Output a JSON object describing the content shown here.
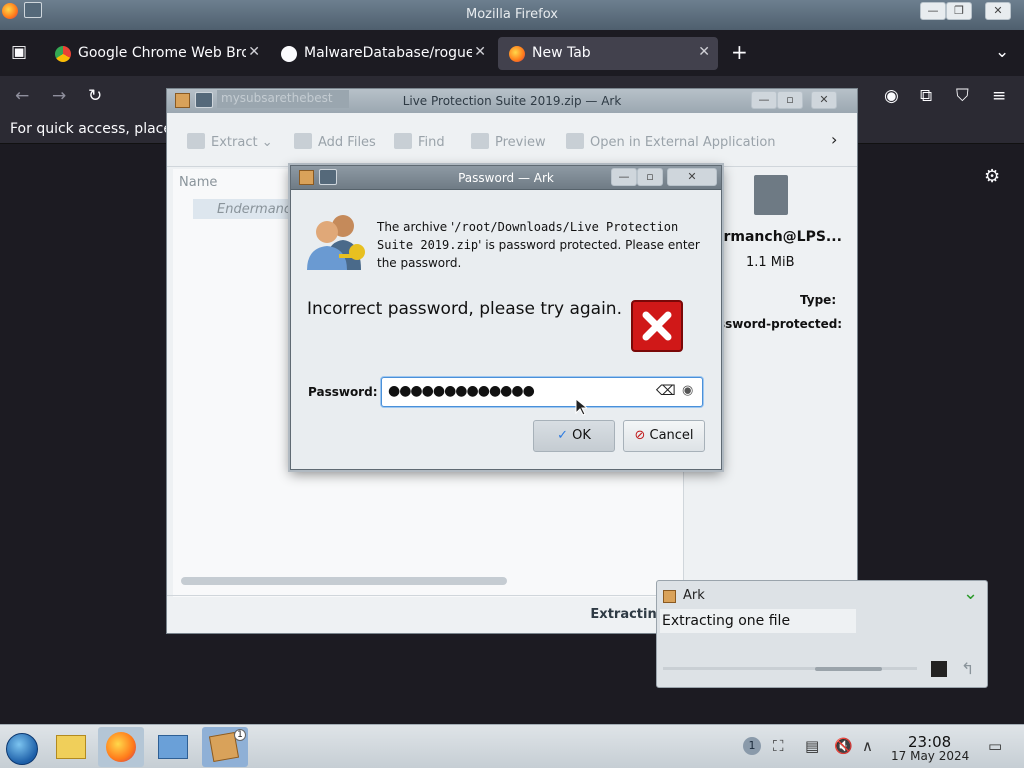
{
  "firefox": {
    "window_title": "Mozilla Firefox",
    "tabs": [
      {
        "label": "Google Chrome Web Bro",
        "active": false
      },
      {
        "label": "MalwareDatabase/rogue",
        "active": false
      },
      {
        "label": "New Tab",
        "active": true
      }
    ],
    "bookmarks_hint": "For quick access, place y"
  },
  "ark": {
    "window_title": "Live Protection Suite 2019.zip — Ark",
    "titlebar_overlay": "mysubsarethebest",
    "toolbar": {
      "extract": "Extract",
      "add_files": "Add Files",
      "find": "Find",
      "preview": "Preview",
      "open_external": "Open in External Application"
    },
    "list": {
      "column_name": "Name",
      "row_name": "Endermanch"
    },
    "info": {
      "name": "ermanch@LPS...",
      "size": "1.1 MiB",
      "type_label": "Type:",
      "protected_label": "ssword-protected:"
    },
    "status": "Extracting one file"
  },
  "dialog": {
    "title": "Password — Ark",
    "message_1": "The archive '",
    "message_path": "/root/Downloads/Live Protection Suite 2019.zip",
    "message_2": "' is password protected. Please enter the password.",
    "error": "Incorrect password, please try again.",
    "password_label": "Password:",
    "password_value": "●●●●●●●●●●●●●",
    "ok": "OK",
    "cancel": "Cancel"
  },
  "notification": {
    "app": "Ark",
    "body": "Extracting one file",
    "progress": 0.3
  },
  "taskbar": {
    "time": "23:08",
    "date": "17 May 2024",
    "notification_count": "1"
  }
}
